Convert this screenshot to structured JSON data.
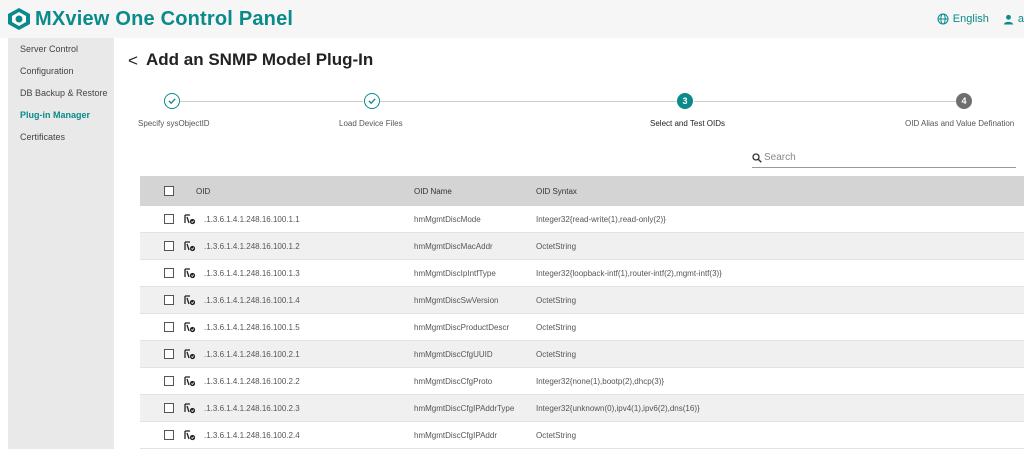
{
  "app": {
    "title": "MXview One Control Panel"
  },
  "header": {
    "language": "English",
    "user": "a"
  },
  "sidebar": {
    "items": [
      {
        "label": "Server Control",
        "active": false
      },
      {
        "label": "Configuration",
        "active": false
      },
      {
        "label": "DB Backup & Restore",
        "active": false
      },
      {
        "label": "Plug-in Manager",
        "active": true
      },
      {
        "label": "Certificates",
        "active": false
      }
    ]
  },
  "page": {
    "back": "<",
    "title": "Add an SNMP Model Plug-In"
  },
  "stepper": {
    "steps": [
      {
        "number": "1",
        "label": "Specify sysObjectID",
        "state": "done"
      },
      {
        "number": "2",
        "label": "Load Device Files",
        "state": "done"
      },
      {
        "number": "3",
        "label": "Select and Test OIDs",
        "state": "current"
      },
      {
        "number": "4",
        "label": "OID Alias and Value Defination",
        "state": "pending"
      }
    ]
  },
  "search": {
    "placeholder": "Search"
  },
  "table": {
    "headers": {
      "oid": "OID",
      "name": "OID Name",
      "syntax": "OID Syntax"
    },
    "rows": [
      {
        "oid": ".1.3.6.1.4.1.248.16.100.1.1",
        "name": "hmMgmtDiscMode",
        "syntax": "Integer32{read-write(1),read-only(2)}"
      },
      {
        "oid": ".1.3.6.1.4.1.248.16.100.1.2",
        "name": "hmMgmtDiscMacAddr",
        "syntax": "OctetString"
      },
      {
        "oid": ".1.3.6.1.4.1.248.16.100.1.3",
        "name": "hmMgmtDiscIpIntfType",
        "syntax": "Integer32{loopback-intf(1),router-intf(2),mgmt-intf(3)}"
      },
      {
        "oid": ".1.3.6.1.4.1.248.16.100.1.4",
        "name": "hmMgmtDiscSwVersion",
        "syntax": "OctetString"
      },
      {
        "oid": ".1.3.6.1.4.1.248.16.100.1.5",
        "name": "hmMgmtDiscProductDescr",
        "syntax": "OctetString"
      },
      {
        "oid": ".1.3.6.1.4.1.248.16.100.2.1",
        "name": "hmMgmtDiscCfgUUID",
        "syntax": "OctetString"
      },
      {
        "oid": ".1.3.6.1.4.1.248.16.100.2.2",
        "name": "hmMgmtDiscCfgProto",
        "syntax": "Integer32{none(1),bootp(2),dhcp(3)}"
      },
      {
        "oid": ".1.3.6.1.4.1.248.16.100.2.3",
        "name": "hmMgmtDiscCfgIPAddrType",
        "syntax": "Integer32{unknown(0),ipv4(1),ipv6(2),dns(16)}"
      },
      {
        "oid": ".1.3.6.1.4.1.248.16.100.2.4",
        "name": "hmMgmtDiscCfgIPAddr",
        "syntax": "OctetString"
      }
    ]
  },
  "colors": {
    "brand": "#0a8a8a",
    "header_bg": "#d4d4d4",
    "sidebar_bg": "#e9e9e9"
  }
}
